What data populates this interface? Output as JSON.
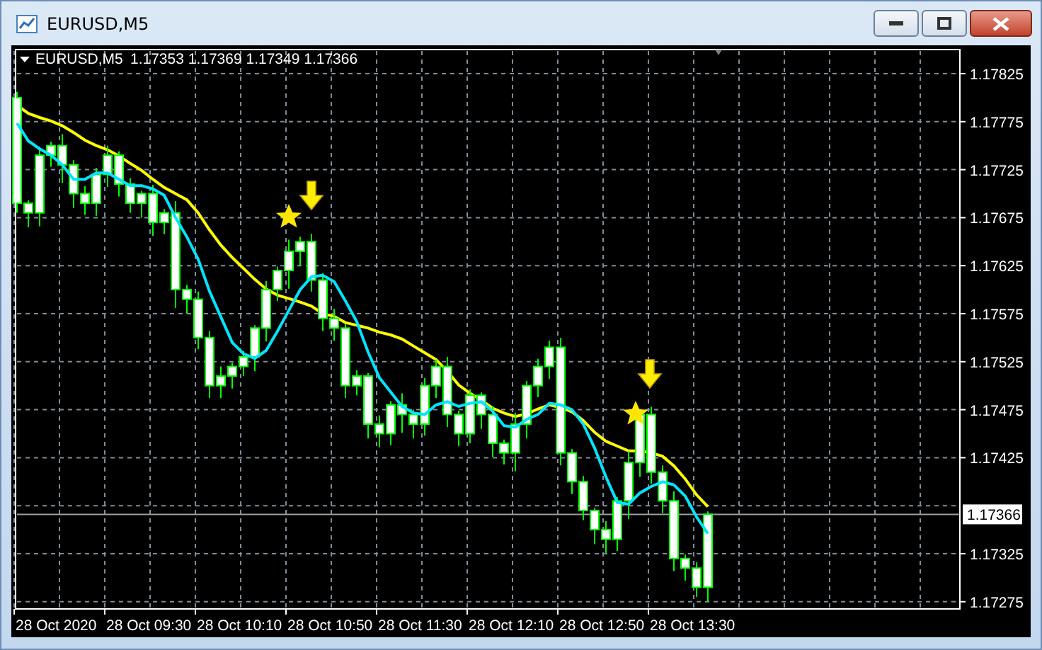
{
  "window": {
    "title": "EURUSD,M5"
  },
  "chart": {
    "symbol": "EURUSD,M5",
    "ohlc": "1.17353 1.17369 1.17349 1.17366",
    "price_ticks": [
      "1.17825",
      "1.17775",
      "1.17725",
      "1.17675",
      "1.17625",
      "1.17575",
      "1.17525",
      "1.17475",
      "1.17425",
      "1.17325",
      "1.17275"
    ],
    "current_price": "1.17366",
    "time_labels": [
      "28 Oct 2020",
      "28 Oct 09:30",
      "28 Oct 10:10",
      "28 Oct 10:50",
      "28 Oct 11:30",
      "28 Oct 12:10",
      "28 Oct 12:50",
      "28 Oct 13:30"
    ]
  }
}
